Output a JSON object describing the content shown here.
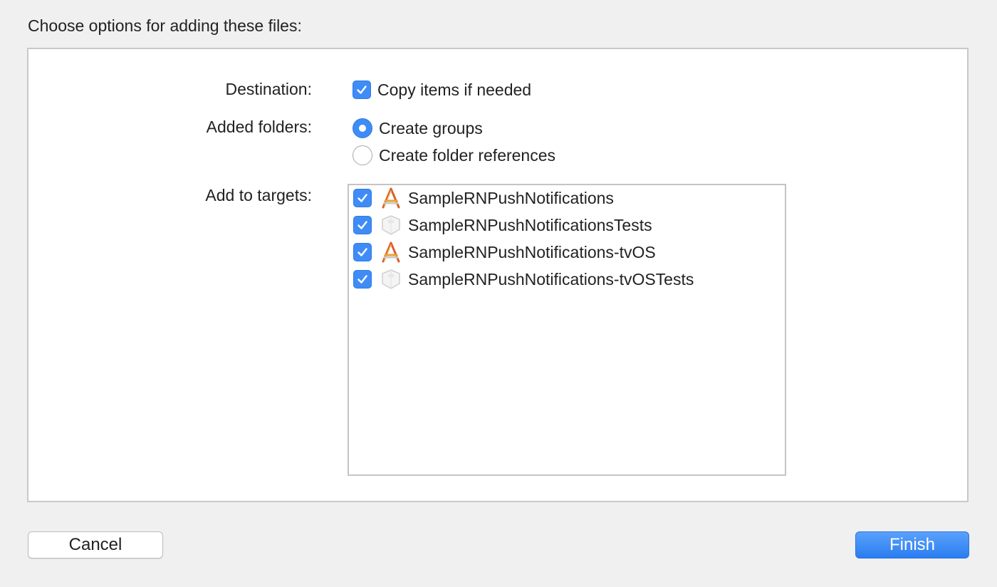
{
  "dialog": {
    "heading": "Choose options for adding these files:"
  },
  "destination": {
    "label": "Destination:",
    "option_label": "Copy items if needed",
    "checked": true
  },
  "added_folders": {
    "label": "Added folders:",
    "options": [
      {
        "label": "Create groups",
        "selected": true
      },
      {
        "label": "Create folder references",
        "selected": false
      }
    ]
  },
  "targets": {
    "label": "Add to targets:",
    "items": [
      {
        "name": "SampleRNPushNotifications",
        "checked": true,
        "icon": "app-target-icon"
      },
      {
        "name": "SampleRNPushNotificationsTests",
        "checked": true,
        "icon": "test-bundle-icon"
      },
      {
        "name": "SampleRNPushNotifications-tvOS",
        "checked": true,
        "icon": "app-target-icon"
      },
      {
        "name": "SampleRNPushNotifications-tvOSTests",
        "checked": true,
        "icon": "test-bundle-icon"
      }
    ]
  },
  "buttons": {
    "cancel_label": "Cancel",
    "finish_label": "Finish"
  },
  "colors": {
    "accent": "#3f8cf6",
    "background": "#f0f0f0",
    "panel": "#ffffff"
  }
}
